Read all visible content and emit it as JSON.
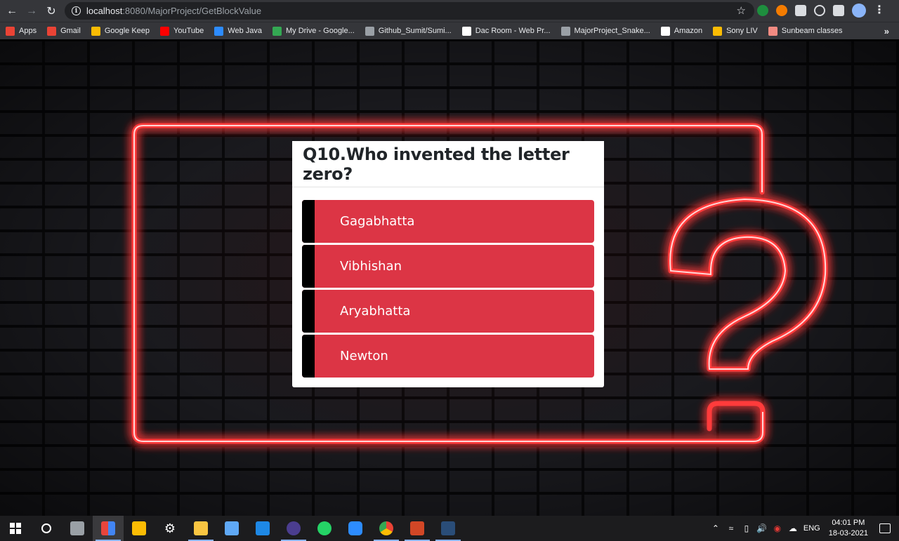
{
  "browser": {
    "url_host": "localhost",
    "url_path": ":8080/MajorProject/GetBlockValue",
    "bookmarks": [
      {
        "label": "Apps",
        "color": "#ea4335"
      },
      {
        "label": "Gmail",
        "color": "#ea4335"
      },
      {
        "label": "Google Keep",
        "color": "#fbbc04"
      },
      {
        "label": "YouTube",
        "color": "#ff0000"
      },
      {
        "label": "Web Java",
        "color": "#2d8cff"
      },
      {
        "label": "My Drive - Google...",
        "color": "#34a853"
      },
      {
        "label": "Github_Sumit/Sumi...",
        "color": "#9aa0a6"
      },
      {
        "label": "Dac Room - Web Pr...",
        "color": "#ffffff"
      },
      {
        "label": "MajorProject_Snake...",
        "color": "#9aa0a6"
      },
      {
        "label": "Amazon",
        "color": "#ffffff"
      },
      {
        "label": "Sony LIV",
        "color": "#fbbc04"
      },
      {
        "label": "Sunbeam classes",
        "color": "#f28b82"
      }
    ],
    "more_label": "»"
  },
  "quiz": {
    "question": "Q10.Who invented the letter zero?",
    "options": [
      "Gagabhatta",
      "Vibhishan",
      "Aryabhatta",
      "Newton"
    ],
    "option_color": "#dc3545"
  },
  "taskbar": {
    "language": "ENG",
    "time": "04:01 PM",
    "date": "18-03-2021",
    "apps": [
      "camera",
      "app-red-blue",
      "sticky-notes",
      "settings",
      "file-explorer",
      "3d-viewer",
      "vscode",
      "eclipse",
      "whatsapp",
      "zoom",
      "chrome",
      "powerpoint",
      "sql-workbench"
    ]
  }
}
